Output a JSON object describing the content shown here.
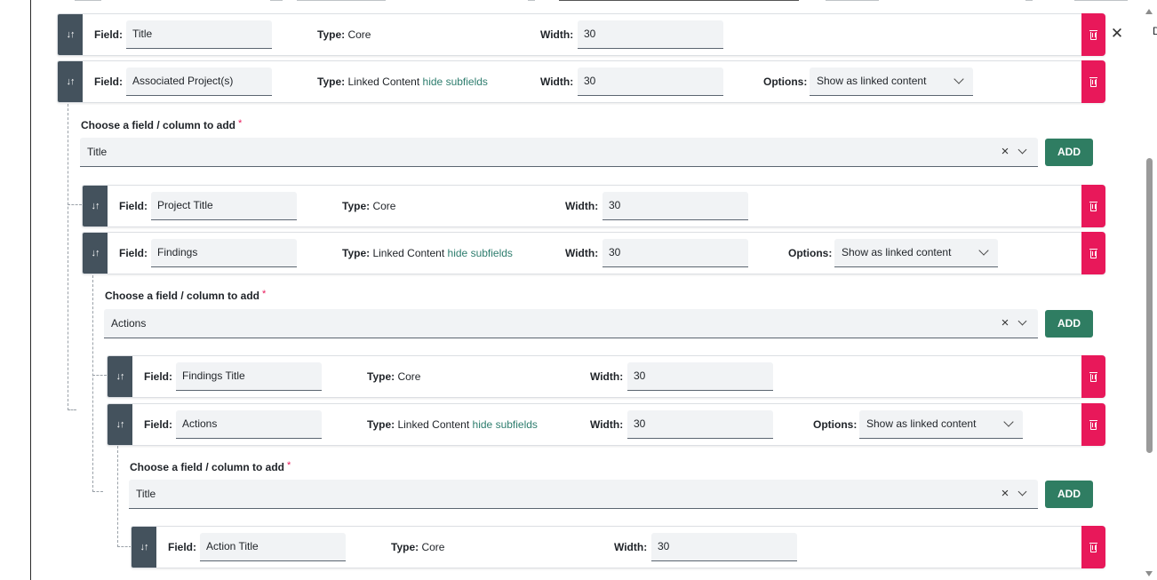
{
  "labels": {
    "field": "Field:",
    "type": "Type:",
    "width": "Width:",
    "options": "Options:",
    "choose": "Choose a field / column to add",
    "required_mark": "*",
    "add": "ADD",
    "hide_subfields": "hide subfields"
  },
  "rows": [
    {
      "field": "Title",
      "type": "Core",
      "width": "30"
    },
    {
      "field": "Associated Project(s)",
      "type": "Linked Content",
      "width": "30",
      "option": "Show as linked content"
    },
    {
      "field": "Project Title",
      "type": "Core",
      "width": "30"
    },
    {
      "field": "Findings",
      "type": "Linked Content",
      "width": "30",
      "option": "Show as linked content"
    },
    {
      "field": "Findings Title",
      "type": "Core",
      "width": "30"
    },
    {
      "field": "Actions",
      "type": "Linked Content",
      "width": "30",
      "option": "Show as linked content"
    },
    {
      "field": "Action Title",
      "type": "Core",
      "width": "30"
    }
  ],
  "pickers": [
    {
      "value": "Title"
    },
    {
      "value": "Actions"
    },
    {
      "value": "Title"
    }
  ],
  "icons": {
    "drag": "sort-arrows-icon",
    "delete": "trash-icon",
    "close": "close-icon",
    "clear": "clear-icon",
    "dropdown": "chevron-down-icon"
  },
  "colors": {
    "drag_handle": "#44525d",
    "delete": "#e8185a",
    "add": "#2f7d62",
    "link": "#2e7d6e",
    "input_bg": "#f1f3f5"
  }
}
